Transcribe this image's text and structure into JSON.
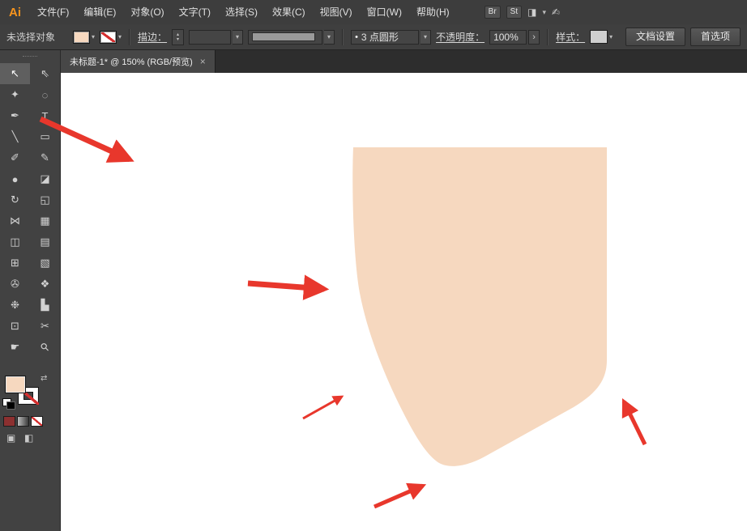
{
  "menubar": {
    "logo": "Ai",
    "items": [
      {
        "label": "文件(F)"
      },
      {
        "label": "编辑(E)"
      },
      {
        "label": "对象(O)"
      },
      {
        "label": "文字(T)"
      },
      {
        "label": "选择(S)"
      },
      {
        "label": "效果(C)"
      },
      {
        "label": "视图(V)"
      },
      {
        "label": "窗口(W)"
      },
      {
        "label": "帮助(H)"
      }
    ],
    "bridge_badge": "Br",
    "stock_badge": "St"
  },
  "controlbar": {
    "selection_status": "未选择对象",
    "stroke_label": "描边：",
    "stroke_weight_value": "",
    "brush_dot": "•",
    "brush_value": "3 点圆形",
    "opacity_label": "不透明度：",
    "opacity_value": "100%",
    "style_label": "样式：",
    "document_setup_label": "文档设置",
    "preferences_label": "首选项"
  },
  "tabbar": {
    "document_title": "未标题-1* @ 150% (RGB/预览)",
    "close_glyph": "×"
  },
  "tools": [
    {
      "name": "selection",
      "glyph": "↖"
    },
    {
      "name": "direct-selection",
      "glyph": "⇖"
    },
    {
      "name": "magic-wand",
      "glyph": "✦"
    },
    {
      "name": "lasso",
      "glyph": "◌"
    },
    {
      "name": "pen",
      "glyph": "✒"
    },
    {
      "name": "type",
      "glyph": "T"
    },
    {
      "name": "line-segment",
      "glyph": "╲"
    },
    {
      "name": "rectangle",
      "glyph": "▭"
    },
    {
      "name": "paintbrush",
      "glyph": "✐"
    },
    {
      "name": "pencil",
      "glyph": "✎"
    },
    {
      "name": "blob-brush",
      "glyph": "●"
    },
    {
      "name": "eraser",
      "glyph": "◪"
    },
    {
      "name": "rotate",
      "glyph": "↻"
    },
    {
      "name": "scale",
      "glyph": "◱"
    },
    {
      "name": "width",
      "glyph": "⋈"
    },
    {
      "name": "free-transform",
      "glyph": "▦"
    },
    {
      "name": "shape-builder",
      "glyph": "◫"
    },
    {
      "name": "perspective-grid",
      "glyph": "▤"
    },
    {
      "name": "mesh",
      "glyph": "⊞"
    },
    {
      "name": "gradient",
      "glyph": "▧"
    },
    {
      "name": "eyedropper",
      "glyph": "✇"
    },
    {
      "name": "blend",
      "glyph": "❖"
    },
    {
      "name": "symbol-sprayer",
      "glyph": "❉"
    },
    {
      "name": "column-graph",
      "glyph": "▙"
    },
    {
      "name": "artboard",
      "glyph": "⊡"
    },
    {
      "name": "slice",
      "glyph": "✂"
    },
    {
      "name": "hand",
      "glyph": "☛"
    },
    {
      "name": "zoom",
      "glyph": "⚲"
    }
  ],
  "ui": {
    "chevron_down": "▾",
    "spinner_up": "▴",
    "spinner_down": "▾",
    "panel_arrow": "›",
    "swap": "⇄",
    "workspace": "◨",
    "touch": "✍",
    "draw_mode": "▣",
    "screen_mode": "◧"
  },
  "colors": {
    "panel_bg": "#3f3f3f",
    "menubar_bg": "#3d3d3d",
    "tabstrip_bg": "#2d2d2d",
    "tab_bg": "#474747",
    "tool_selected_bg": "#5f5f5f",
    "accent_orange": "#f7941d",
    "shape_fill": "#f6d8bf",
    "arrow_red": "#e8372c",
    "stroke_slash_red": "#d62f2f",
    "canvas_bg": "#ffffff",
    "profile_gray": "#9a9a9a",
    "color_button_bg": "#8c3030"
  }
}
